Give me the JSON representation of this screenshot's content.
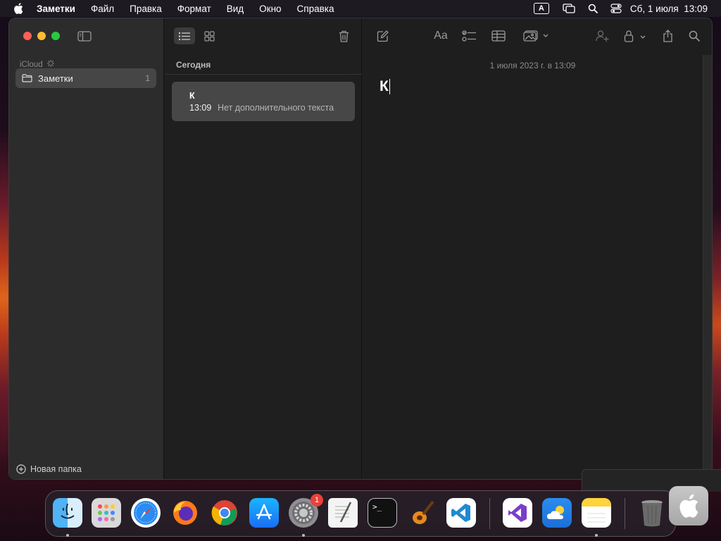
{
  "menubar": {
    "app_name": "Заметки",
    "items": [
      "Файл",
      "Правка",
      "Формат",
      "Вид",
      "Окно",
      "Справка"
    ],
    "input_indicator": "A",
    "clock": "Сб, 1 июля  13:09"
  },
  "sidebar": {
    "section": "iCloud",
    "folder": {
      "label": "Заметки",
      "count": "1"
    },
    "new_folder": "Новая папка"
  },
  "list": {
    "section_header": "Сегодня",
    "notes": [
      {
        "title": "К",
        "time": "13:09",
        "preview": "Нет дополнительного текста"
      }
    ]
  },
  "editor": {
    "date": "1 июля 2023 г. в 13:09",
    "body": "К"
  },
  "dock": {
    "badge": "1",
    "apps": [
      "finder",
      "launchpad",
      "safari",
      "firefox",
      "chrome",
      "app-store",
      "system-settings",
      "textedit",
      "terminal",
      "garageband",
      "vscode",
      "visual-studio",
      "weather",
      "notes",
      "trash"
    ]
  },
  "colors": {
    "traffic_red": "#ff5f57",
    "traffic_yellow": "#febc2e",
    "traffic_green": "#28c840",
    "selected_folder": "#464646",
    "selected_note": "#474747"
  }
}
